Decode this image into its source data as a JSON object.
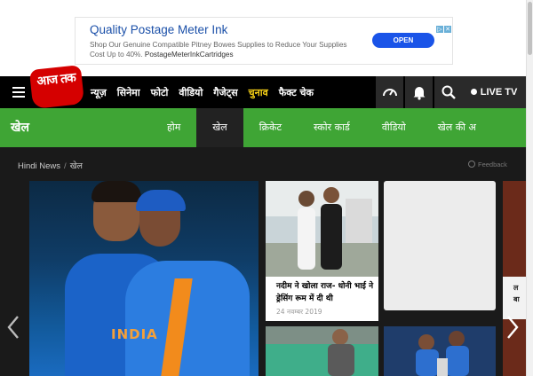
{
  "ad": {
    "title": "Quality Postage Meter Ink",
    "body_line1": "Shop Our Genuine Compatible Pitney Bowes Supplies to Reduce Your Supplies",
    "body_line2": "Cost Up to 40%.",
    "site": "PostageMeterInkCartridges",
    "button": "OPEN"
  },
  "logo": {
    "text": "आज तक"
  },
  "nav": {
    "items": [
      "न्यूज़",
      "सिनेमा",
      "फोटो",
      "वीडियो",
      "गैजेट्स",
      "चुनाव",
      "फैक्ट चेक"
    ],
    "highlight_index": 5,
    "live_tv": "LIVE TV"
  },
  "subnav": {
    "title": "खेल",
    "items": [
      "होम",
      "खेल",
      "क्रिकेट",
      "स्कोर कार्ड",
      "वीडियो",
      "खेल की अ"
    ],
    "active_index": 1
  },
  "breadcrumb": {
    "home": "Hindi News",
    "separator": "/",
    "current": "खेल"
  },
  "feedback": "Feedback",
  "hero": {
    "jersey_text": "INDIA"
  },
  "cards": [
    {
      "headline": "नदीम ने खोला राज- धोनी भाई ने ड्रेसिंग रूम में दी थी",
      "date": "24 नवम्बर 2019"
    }
  ],
  "edge_text": [
    "ल",
    "बा"
  ],
  "colors": {
    "nav_bg": "#000000",
    "sport_green": "#3fa535",
    "brand_red": "#d50000",
    "highlight_yellow": "#f7d117"
  }
}
